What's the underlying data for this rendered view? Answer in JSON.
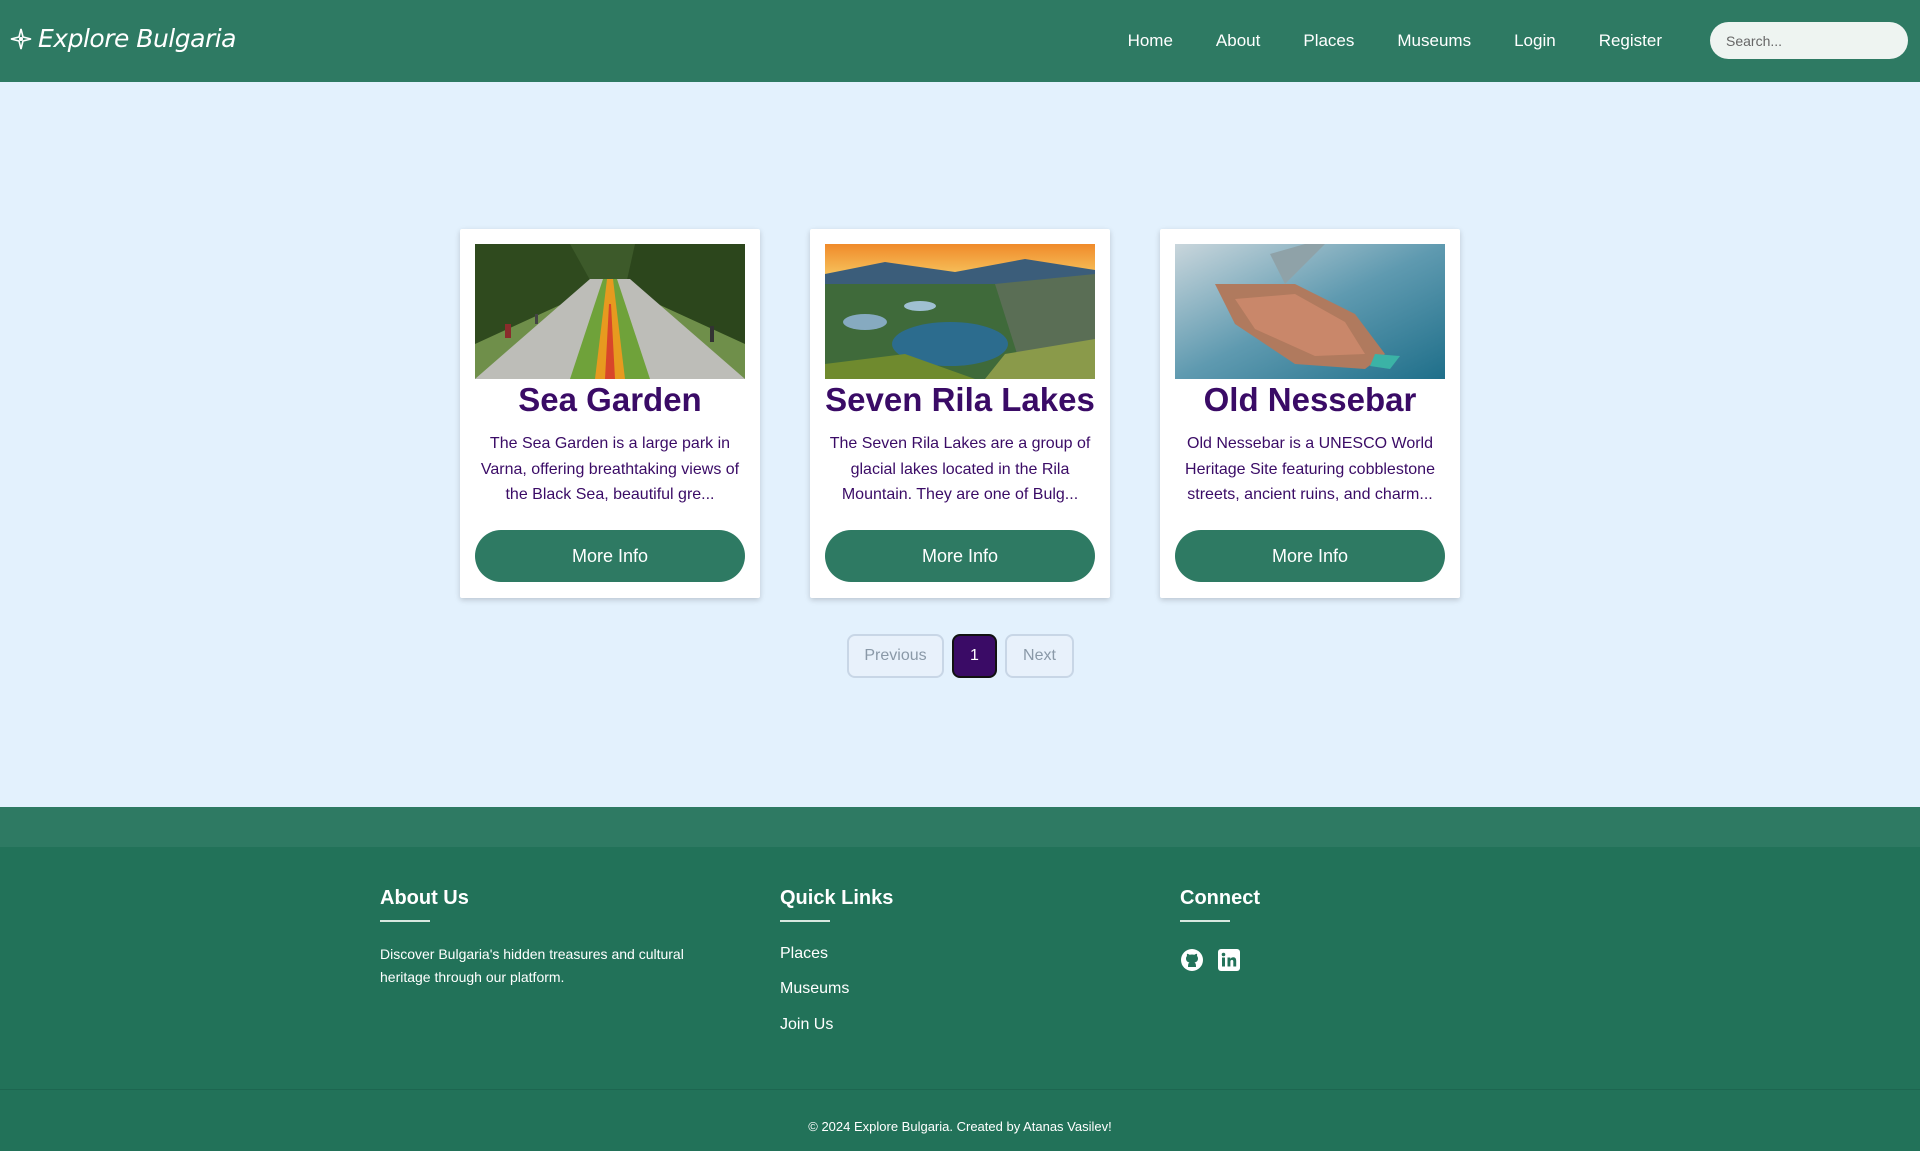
{
  "header": {
    "logo_text": "Explore Bulgaria",
    "nav": [
      "Home",
      "About",
      "Places",
      "Museums",
      "Login",
      "Register"
    ],
    "search_placeholder": "Search..."
  },
  "cards": [
    {
      "title": "Sea Garden",
      "description": "The Sea Garden is a large park in Varna, offering breathtaking views of the Black Sea, beautiful gre...",
      "button": "More Info"
    },
    {
      "title": "Seven Rila Lakes",
      "description": "The Seven Rila Lakes are a group of glacial lakes located in the Rila Mountain. They are one of Bulg...",
      "button": "More Info"
    },
    {
      "title": "Old Nessebar",
      "description": "Old Nessebar is a UNESCO World Heritage Site featuring cobblestone streets, ancient ruins, and charm...",
      "button": "More Info"
    }
  ],
  "pagination": {
    "previous": "Previous",
    "current": "1",
    "next": "Next"
  },
  "footer": {
    "about": {
      "heading": "About Us",
      "text": "Discover Bulgaria's hidden treasures and cultural heritage through our platform."
    },
    "quick_links": {
      "heading": "Quick Links",
      "links": [
        "Places",
        "Museums",
        "Join Us"
      ]
    },
    "connect": {
      "heading": "Connect",
      "icons": [
        "github-icon",
        "linkedin-icon"
      ]
    },
    "copyright": "© 2024 Explore Bulgaria. Created by Atanas Vasilev!"
  },
  "colors": {
    "primary": "#2e7a63",
    "accent_purple": "#3a0b66",
    "background": "#e3f1fd"
  }
}
